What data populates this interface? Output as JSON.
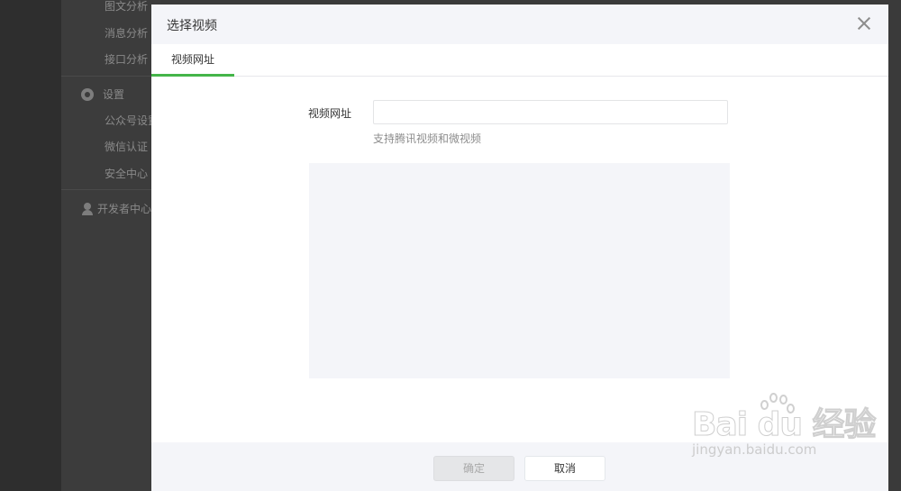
{
  "background": {
    "sidebar_items": [
      {
        "label": "图文分析"
      },
      {
        "label": "消息分析"
      },
      {
        "label": "接口分析"
      }
    ],
    "settings_group": {
      "label": "设置",
      "icon": "gear-icon"
    },
    "settings_items": [
      {
        "label": "公众号设置"
      },
      {
        "label": "微信认证"
      },
      {
        "label": "安全中心"
      }
    ],
    "developer_group": {
      "label": "开发者中心",
      "icon": "person-icon"
    }
  },
  "dialog": {
    "title": "选择视频",
    "close_icon": "close-icon",
    "tabs": [
      {
        "label": "视频网址",
        "active": true
      }
    ],
    "form": {
      "label": "视频网址",
      "input_value": "",
      "input_placeholder": "",
      "tip": "支持腾讯视频和微视频"
    },
    "footer": {
      "confirm_label": "确定",
      "confirm_disabled": true,
      "cancel_label": "取消"
    }
  },
  "watermark": {
    "logo": "Bai du 经验",
    "url": "jingyan.baidu.com"
  },
  "colors": {
    "accent": "#44b549",
    "overlay": "#3b3b3b",
    "header_bg": "#f4f5f9"
  }
}
